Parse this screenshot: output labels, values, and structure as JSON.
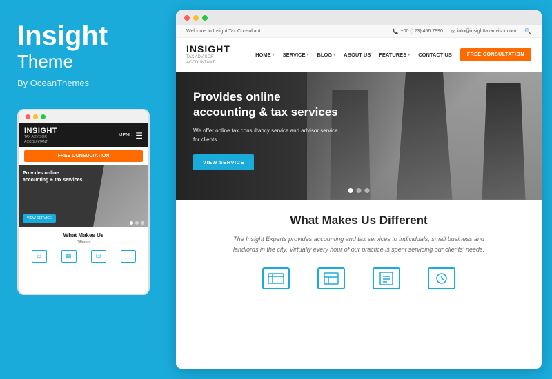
{
  "left": {
    "brand_title": "Insight",
    "brand_subtitle": "Theme",
    "brand_by": "By OceanThemes"
  },
  "mobile": {
    "logo_text": "INSIGHT",
    "logo_sub_line1": "TAX ADVISOR",
    "logo_sub_line2": "ACCOUNTANT",
    "menu_label": "MENU",
    "cta_btn": "FREE CONSULTATION",
    "hero_title": "Provides online accounting & tax services",
    "view_btn": "VIEW SERVICE",
    "what_title": "What Makes Us",
    "what_sub": "Different"
  },
  "desktop": {
    "header_welcome": "Welcome to Insight Tax Consultant.",
    "header_phone": "+00 (123) 456 7890",
    "header_email": "info@insighttaxadvisor.com",
    "logo_text": "INSIGHT",
    "logo_sub_line1": "TAX ADVISOR",
    "logo_sub_line2": "ACCOUNTANT",
    "nav": {
      "home": "HOME",
      "service": "SERVICE",
      "blog": "BLOG",
      "about": "ABOUT US",
      "features": "FEATURES",
      "contact": "CONTACT US",
      "cta": "FREE CONSULTATION"
    },
    "hero": {
      "title": "Provides online accounting & tax services",
      "desc": "We offer online tax consultancy service and advisor service for clients",
      "btn": "VIEW SERVICE"
    },
    "wmud": {
      "title": "What Makes Us Different",
      "desc": "The Insight Experts provides accounting and tax services to individuals, small business and landlords in the city. Virtually every hour of our practice is spent servicing our clients' needs."
    }
  }
}
